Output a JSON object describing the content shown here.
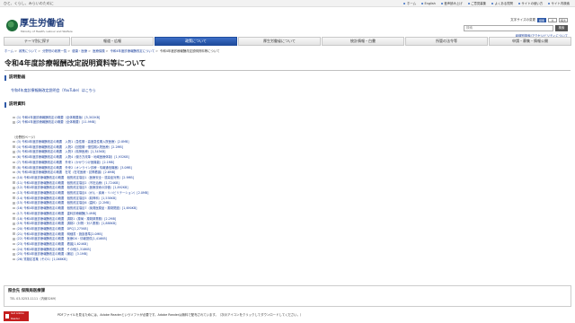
{
  "topbar": {
    "tagline": "ひと、くらし、みらいのために",
    "links": [
      "ホーム",
      "English",
      "音声読み上げ",
      "ご意見募集",
      "よくある質問",
      "サイトの使い方",
      "サイト内検索"
    ]
  },
  "header": {
    "logo_title": "厚生労働省",
    "logo_sub": "Ministry of Health, Labour and Welfare",
    "fontsize_label": "文字サイズの変更",
    "fontsize_options": [
      "標準",
      "大",
      "特大"
    ],
    "search_placeholder": "検索",
    "search_button": "検索",
    "access_link": "組織別検索/アクセシビリティについて",
    "site_link": "厚労省公式ページ"
  },
  "nav": {
    "items": [
      {
        "label": "テーマ別に探す",
        "active": false
      },
      {
        "label": "報道・広報",
        "active": false
      },
      {
        "label": "政策について",
        "active": true
      },
      {
        "label": "厚生労働省について",
        "active": false
      },
      {
        "label": "統計情報・白書",
        "active": false
      },
      {
        "label": "所管の法令等",
        "active": false
      },
      {
        "label": "申請・募集・情報公開",
        "active": false
      }
    ]
  },
  "breadcrumb": {
    "items": [
      "ホーム",
      "政策について",
      "分野別の政策一覧",
      "健康・医療",
      "医療保険",
      "令和4年度診療報酬改定について"
    ],
    "current": "令和4年度診療報酬改定説明資料等について"
  },
  "page": {
    "title": "令和4年度診療報酬改定説明資料等について"
  },
  "sections": {
    "video_heading": "説明動画",
    "video_link": "令和4年度診療報酬改定説明会（YouTube）はこちら",
    "materials_heading": "説明資料"
  },
  "materials_top": [
    "(1) 令和4年度診療報酬改定の概要（全体概要版）[5,302KB]",
    "(2) 令和4年度診療報酬改定の概要（全体概要）[11.9MB]"
  ],
  "materials_note": "（分野別ページ）",
  "materials": [
    "(3) 令和4年度診療報酬改定の概要　入院1（急性期・高度急性期入院医療）[2.8MB]",
    "(4) 令和4年度診療報酬改定の概要　入院2（回復期・慢性期入院医療）[2.2MB]",
    "(5) 令和4年度診療報酬改定の概要　入院3（精神医療）[1,345KB]",
    "(6) 令和4年度診療報酬改定の概要　入院4（働き方改革・地域医療体制）[1,932KB]",
    "(7) 令和4年度診療報酬改定の概要　外来1（かかりつけ医機能）[2.1MB]",
    "(8) 令和4年度診療報酬改定の概要　外来2（オンライン診療・情報通信機器）[3.0MB]",
    "(9) 令和4年度診療報酬改定の概要　在宅（在宅医療・訪問看護）[2.6MB]",
    "(10) 令和4年度診療報酬改定の概要　個別改定項目1（医療安全・感染症対策）[2.9MB]",
    "(11) 令和4年度診療報酬改定の概要　個別改定項目2（不妊治療）[1,724KB]",
    "(12) 令和4年度診療報酬改定の概要　個別改定項目3（医療技術の評価）[1,892KB]",
    "(13) 令和4年度診療報酬改定の概要　個別改定項目4（がん・疾病・リハビリテーション）[2.0MB]",
    "(14) 令和4年度診療報酬改定の概要　個別改定項目5（精神科）[1,538KB]",
    "(15) 令和4年度診療報酬改定の概要　個別改定項目6（歯科）[2.2MB]",
    "(16) 令和4年度診療報酬改定の概要　個別改定項目7（後発医薬品・薬剤関連）[1,690KB]",
    "(17) 令和4年度診療報酬改定の概要　歯科診療報酬[3.4MB]",
    "(18) 令和4年度診療報酬改定の概要　調剤1（薬局・薬剤師業務）[2.2MB]",
    "(19) 令和4年度診療報酬改定の概要　調剤2（対物・対人業務）[1,888KB]",
    "(20) 令和4年度診療報酬改定の概要　DPC[1,275KB]",
    "(21) 令和4年度診療報酬改定の概要　明細書・施設基準[2.0MB]",
    "(22) 令和4年度診療報酬改定の概要　医療DX・情報提供[1,416KB]",
    "(23) 令和4年度診療報酬改定の概要　看護[1,624KB]",
    "(24) 令和4年度診療報酬改定の概要　その他[1,318KB]",
    "(25) 令和4年度診療報酬改定の概要（補足）[3.1MB]",
    "(26) 質疑応答集（その1）[1,068KB]"
  ],
  "contact": {
    "title": "照会先 保険局医療課",
    "tel": "TEL 03-5253-1111（内線3269）"
  },
  "adobe": {
    "badge": "Get Adobe Reader",
    "text": "PDFファイルを見るためには、Adobe Readerというソフトが必要です。Adobe Readerは無料で配布されています。（次のアイコンをクリックしてダウンロードしてください。）"
  },
  "colors": {
    "accent": "#2f5aa8",
    "link": "#1a3f9c",
    "logo_green": "#1f6d3a"
  }
}
